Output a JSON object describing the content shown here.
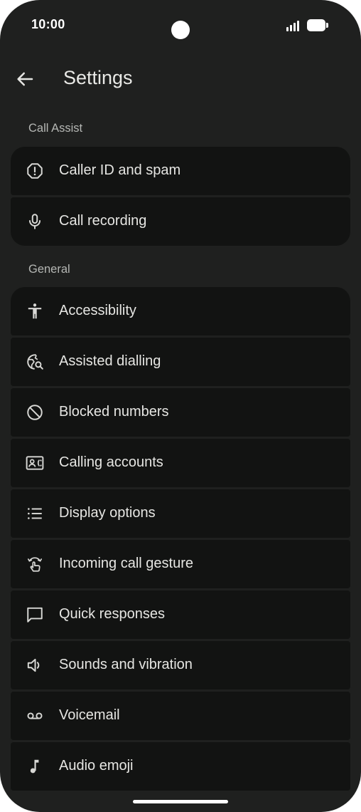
{
  "status_bar": {
    "time": "10:00"
  },
  "header": {
    "title": "Settings"
  },
  "sections": [
    {
      "title": "Call Assist",
      "items": [
        {
          "label": "Caller ID and spam",
          "icon": "caller-id-alert-icon"
        },
        {
          "label": "Call recording",
          "icon": "microphone-icon"
        }
      ]
    },
    {
      "title": "General",
      "items": [
        {
          "label": "Accessibility",
          "icon": "accessibility-icon"
        },
        {
          "label": "Assisted dialling",
          "icon": "globe-search-icon"
        },
        {
          "label": "Blocked numbers",
          "icon": "block-icon"
        },
        {
          "label": "Calling accounts",
          "icon": "contact-card-icon"
        },
        {
          "label": "Display options",
          "icon": "list-icon"
        },
        {
          "label": "Incoming call gesture",
          "icon": "gesture-icon"
        },
        {
          "label": "Quick responses",
          "icon": "chat-bubble-icon"
        },
        {
          "label": "Sounds and vibration",
          "icon": "speaker-icon"
        },
        {
          "label": "Voicemail",
          "icon": "voicemail-icon"
        },
        {
          "label": "Audio emoji",
          "icon": "music-note-icon"
        }
      ]
    }
  ],
  "colors": {
    "background": "#1f201f",
    "card": "#121312",
    "text": "#e6e6e3",
    "section_text": "#b5b7b4"
  }
}
